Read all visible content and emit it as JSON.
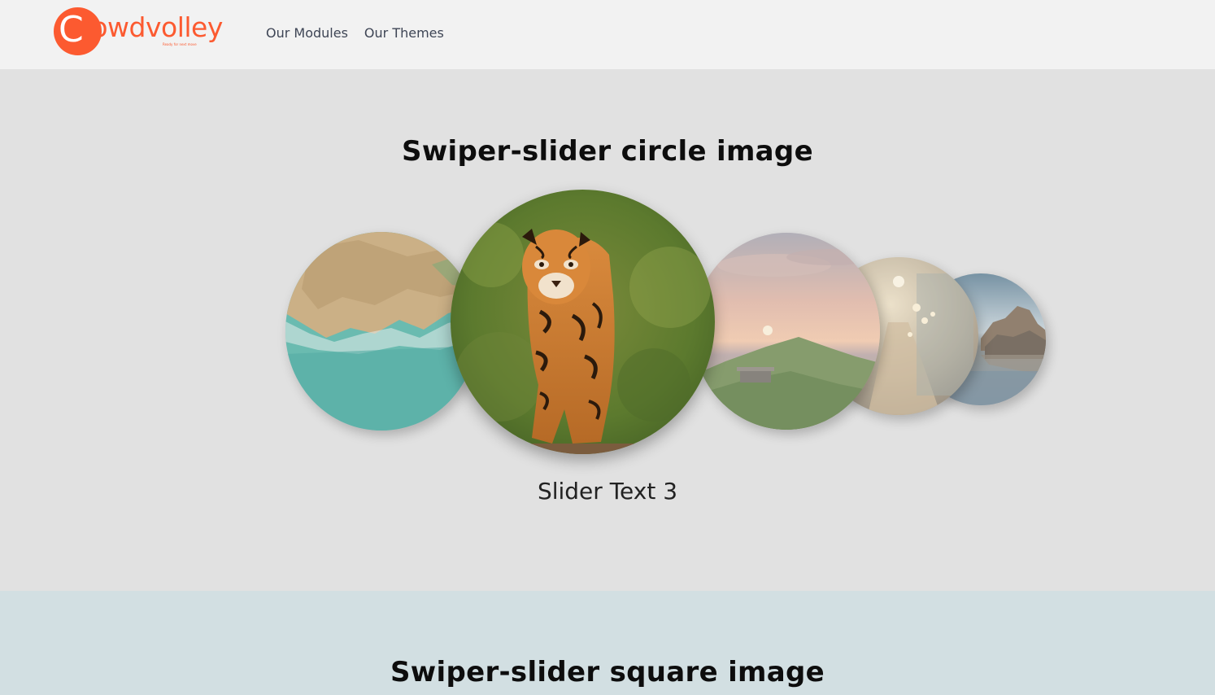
{
  "header": {
    "logo_letter": "C",
    "logo_text": "rowdvolley",
    "logo_tagline": "Ready for next move",
    "nav": [
      {
        "label": "Our Modules"
      },
      {
        "label": "Our Themes"
      }
    ]
  },
  "circle_section": {
    "title": "Swiper-slider circle image",
    "caption": "Slider Text 3",
    "slides": [
      {
        "icon": "coast-aerial-image"
      },
      {
        "icon": "tiger-image"
      },
      {
        "icon": "mountain-sunset-image"
      },
      {
        "icon": "corridor-lights-image"
      },
      {
        "icon": "lake-rocks-image"
      }
    ]
  },
  "square_section": {
    "title": "Swiper-slider square image"
  },
  "colors": {
    "brand": "#fc5a30",
    "header_bg": "#f2f2f2",
    "circle_section_bg": "#e1e1e1",
    "square_section_bg": "#d2dfe2"
  }
}
